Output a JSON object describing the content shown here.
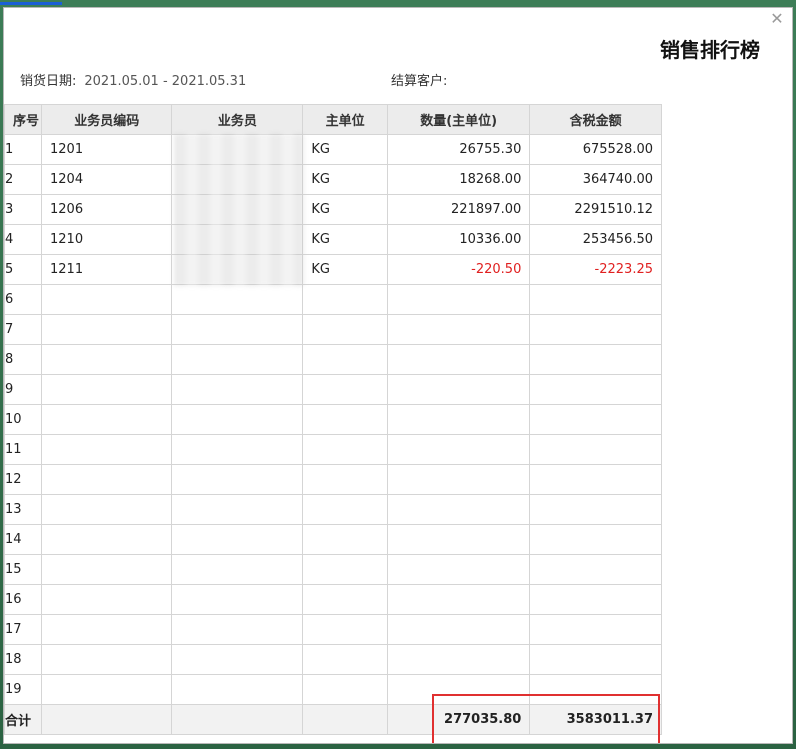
{
  "dialog": {
    "title": "销售排行榜",
    "close_glyph": "✕",
    "date_label": "销货日期:",
    "date_range": "2021.05.01 - 2021.05.31",
    "customer_label": "结算客户:",
    "customer_value": ""
  },
  "table": {
    "headers": [
      "序号",
      "业务员编码",
      "业务员",
      "主单位",
      "数量(主单位)",
      "含税金额"
    ],
    "rows": [
      {
        "idx": "1",
        "code": "1201",
        "name": "",
        "unit": "KG",
        "qty": "26755.30",
        "amount": "675528.00",
        "negative": false
      },
      {
        "idx": "2",
        "code": "1204",
        "name": "",
        "unit": "KG",
        "qty": "18268.00",
        "amount": "364740.00",
        "negative": false
      },
      {
        "idx": "3",
        "code": "1206",
        "name": "",
        "unit": "KG",
        "qty": "221897.00",
        "amount": "2291510.12",
        "negative": false
      },
      {
        "idx": "4",
        "code": "1210",
        "name": "",
        "unit": "KG",
        "qty": "10336.00",
        "amount": "253456.50",
        "negative": false
      },
      {
        "idx": "5",
        "code": "1211",
        "name": "",
        "unit": "KG",
        "qty": "-220.50",
        "amount": "-2223.25",
        "negative": true
      },
      {
        "idx": "6",
        "code": "",
        "name": "",
        "unit": "",
        "qty": "",
        "amount": "",
        "negative": false
      },
      {
        "idx": "7",
        "code": "",
        "name": "",
        "unit": "",
        "qty": "",
        "amount": "",
        "negative": false
      },
      {
        "idx": "8",
        "code": "",
        "name": "",
        "unit": "",
        "qty": "",
        "amount": "",
        "negative": false
      },
      {
        "idx": "9",
        "code": "",
        "name": "",
        "unit": "",
        "qty": "",
        "amount": "",
        "negative": false
      },
      {
        "idx": "10",
        "code": "",
        "name": "",
        "unit": "",
        "qty": "",
        "amount": "",
        "negative": false
      },
      {
        "idx": "11",
        "code": "",
        "name": "",
        "unit": "",
        "qty": "",
        "amount": "",
        "negative": false
      },
      {
        "idx": "12",
        "code": "",
        "name": "",
        "unit": "",
        "qty": "",
        "amount": "",
        "negative": false
      },
      {
        "idx": "13",
        "code": "",
        "name": "",
        "unit": "",
        "qty": "",
        "amount": "",
        "negative": false
      },
      {
        "idx": "14",
        "code": "",
        "name": "",
        "unit": "",
        "qty": "",
        "amount": "",
        "negative": false
      },
      {
        "idx": "15",
        "code": "",
        "name": "",
        "unit": "",
        "qty": "",
        "amount": "",
        "negative": false
      },
      {
        "idx": "16",
        "code": "",
        "name": "",
        "unit": "",
        "qty": "",
        "amount": "",
        "negative": false
      },
      {
        "idx": "17",
        "code": "",
        "name": "",
        "unit": "",
        "qty": "",
        "amount": "",
        "negative": false
      },
      {
        "idx": "18",
        "code": "",
        "name": "",
        "unit": "",
        "qty": "",
        "amount": "",
        "negative": false
      },
      {
        "idx": "19",
        "code": "",
        "name": "",
        "unit": "",
        "qty": "",
        "amount": "",
        "negative": false
      }
    ],
    "total": {
      "label": "合计",
      "qty": "277035.80",
      "amount": "3583011.37"
    }
  },
  "colors": {
    "negative": "#e02020",
    "highlight": "#e03030",
    "header_bg": "#ececec"
  }
}
